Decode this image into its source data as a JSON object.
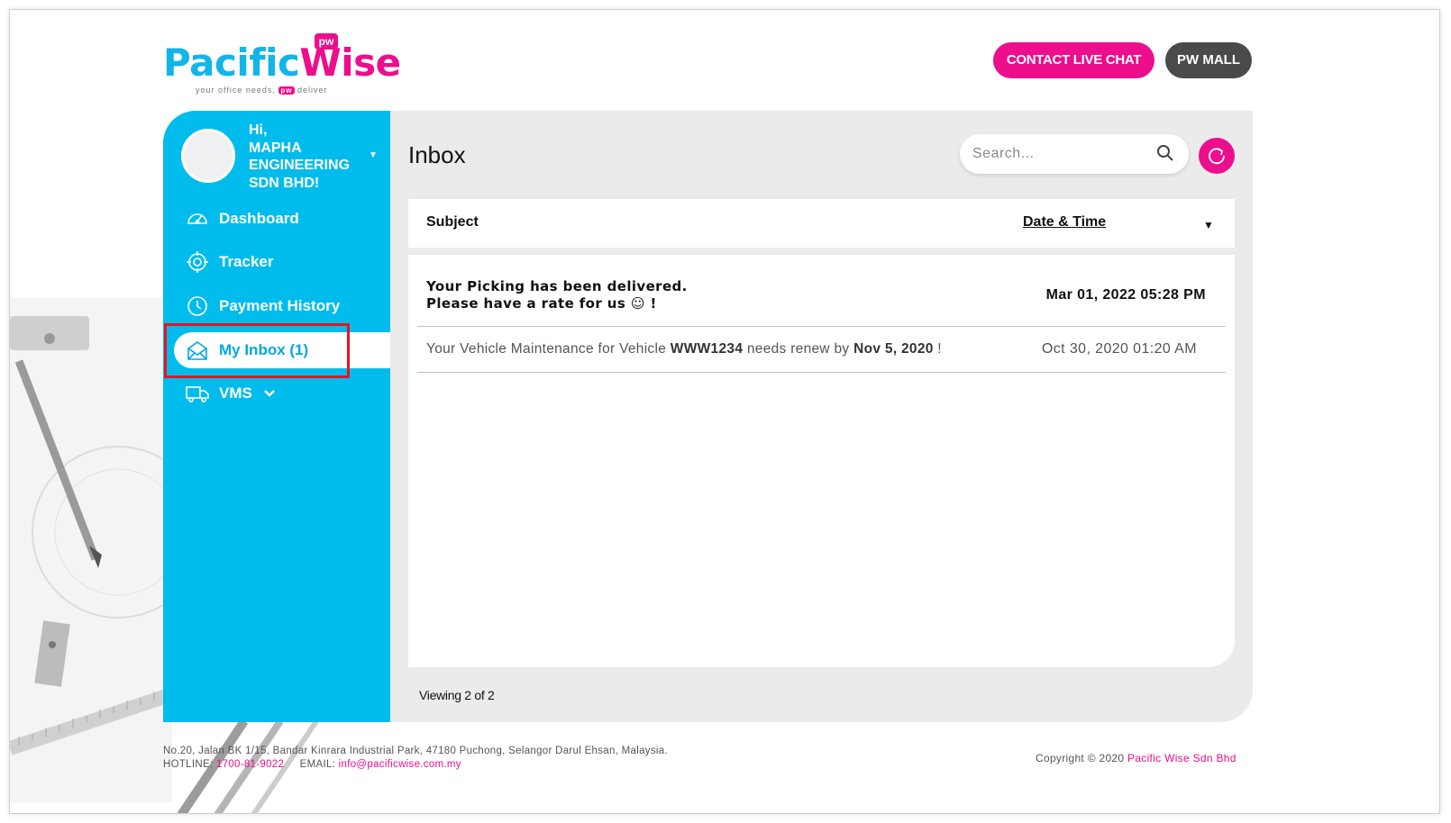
{
  "header": {
    "logo_text_1": "Pac",
    "logo_text_2": "i",
    "logo_text_3": "fic",
    "logo_text_4": "Wise",
    "logo_badge": "pw",
    "logo_tagline_1": "your office needs,",
    "logo_tagline_badge": "pw",
    "logo_tagline_2": "deliver",
    "contact_label": "CONTACT LIVE CHAT",
    "mall_label": "PW MALL"
  },
  "sidebar": {
    "greeting": "Hi,",
    "company": "MAPHA ENGINEERING SDN BHD!",
    "items": [
      {
        "label": "Dashboard",
        "icon": "speedometer-icon"
      },
      {
        "label": "Tracker",
        "icon": "crosshair-icon"
      },
      {
        "label": "Payment History",
        "icon": "clock-icon"
      },
      {
        "label": "My Inbox (1)",
        "icon": "envelope-open-icon",
        "active": true
      },
      {
        "label": "VMS",
        "icon": "truck-icon"
      }
    ]
  },
  "main": {
    "title": "Inbox",
    "search_placeholder": "Search...",
    "columns": {
      "subject": "Subject",
      "date": "Date & Time",
      "sort": "▼"
    },
    "rows": [
      {
        "subject_line1": "Your Picking has been delivered.",
        "subject_line2": "Please have a rate for us ☺ !",
        "datetime": "Mar 01, 2022 05:28 PM",
        "unread": true
      },
      {
        "subject_pre": "Your Vehicle Maintenance for Vehicle ",
        "vehicle": "WWW1234",
        "subject_mid": " needs renew by ",
        "renew_date": "Nov 5, 2020",
        "subject_post": " !",
        "datetime": "Oct 30, 2020 01:20 AM",
        "unread": false
      }
    ],
    "viewing": "Viewing 2 of 2"
  },
  "footer": {
    "address": "No.20, Jalan BK 1/15, Bandar Kinrara Industrial Park, 47180 Puchong, Selangor Darul Ehsan, Malaysia.",
    "hotline_label": "HOTLINE:",
    "hotline": "1700-81-9022",
    "email_label": "EMAIL:",
    "email": "info@pacificwise.com.my",
    "copyright": "Copyright © 2020",
    "company_link": "Pacific Wise Sdn Bhd"
  },
  "colors": {
    "brand_blue": "#00bcec",
    "brand_pink": "#ec0e8c",
    "dark_button": "#4a4a4a",
    "highlight": "#e8131f"
  }
}
